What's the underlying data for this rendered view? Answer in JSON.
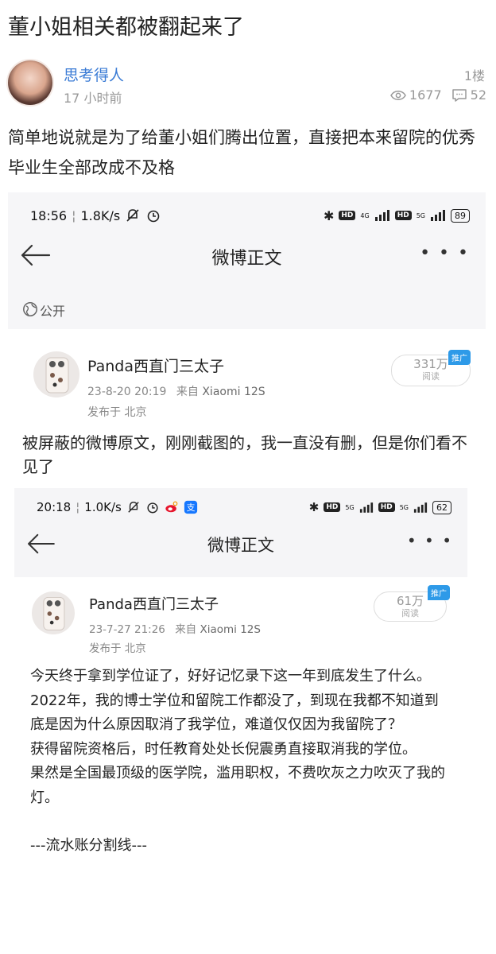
{
  "thread": {
    "title": "董小姐相关都被翻起来了"
  },
  "post": {
    "username": "思考得人",
    "time_ago": "17 小时前",
    "floor": "1楼",
    "views": "1677",
    "comments": "52",
    "text": "简单地说就是为了给董小姐们腾出位置，直接把本来留院的优秀毕业生全部改成不及格"
  },
  "screenshot1": {
    "status_time": "18:56",
    "status_speed": "1.8K/s",
    "signal_1": "4G",
    "signal_2": "5G",
    "battery": "89",
    "hd": "HD",
    "nav_title": "微博正文",
    "more": "• • •",
    "visibility": "公开",
    "author": "Panda西直门三太子",
    "date": "23-8-20 20:19",
    "from_prefix": "来自",
    "device": "Xiaomi 12S",
    "location": "发布于 北京",
    "reads": "331万",
    "reads_unit": "阅读",
    "promo": "推广",
    "text": "被屏蔽的微博原文，刚刚截图的，我一直没有删，但是你们看不见了"
  },
  "screenshot2": {
    "status_time": "20:18",
    "status_speed": "1.0K/s",
    "signal_1": "5G",
    "signal_2": "5G",
    "battery": "62",
    "hd": "HD",
    "nav_title": "微博正文",
    "more": "• • •",
    "author": "Panda西直门三太子",
    "date": "23-7-27 21:26",
    "from_prefix": "来自",
    "device": "Xiaomi 12S",
    "location": "发布于 北京",
    "reads": "61万",
    "reads_unit": "阅读",
    "promo": "推广",
    "paragraphs": [
      "今天终于拿到学位证了，好好记忆录下这一年到底发生了什么。",
      "2022年，我的博士学位和留院工作都没了，到现在我都不知道到底是因为什么原因取消了我学位，难道仅仅因为我留院了？",
      "获得留院资格后，时任教育处处长倪震勇直接取消我的学位。",
      "果然是全国最顶级的医学院，滥用职权，不费吹灰之力吹灭了我的灯。",
      "---流水账分割线---"
    ]
  },
  "colors": {
    "username": "#3a7bd5",
    "promo": "#2e9ae8"
  }
}
